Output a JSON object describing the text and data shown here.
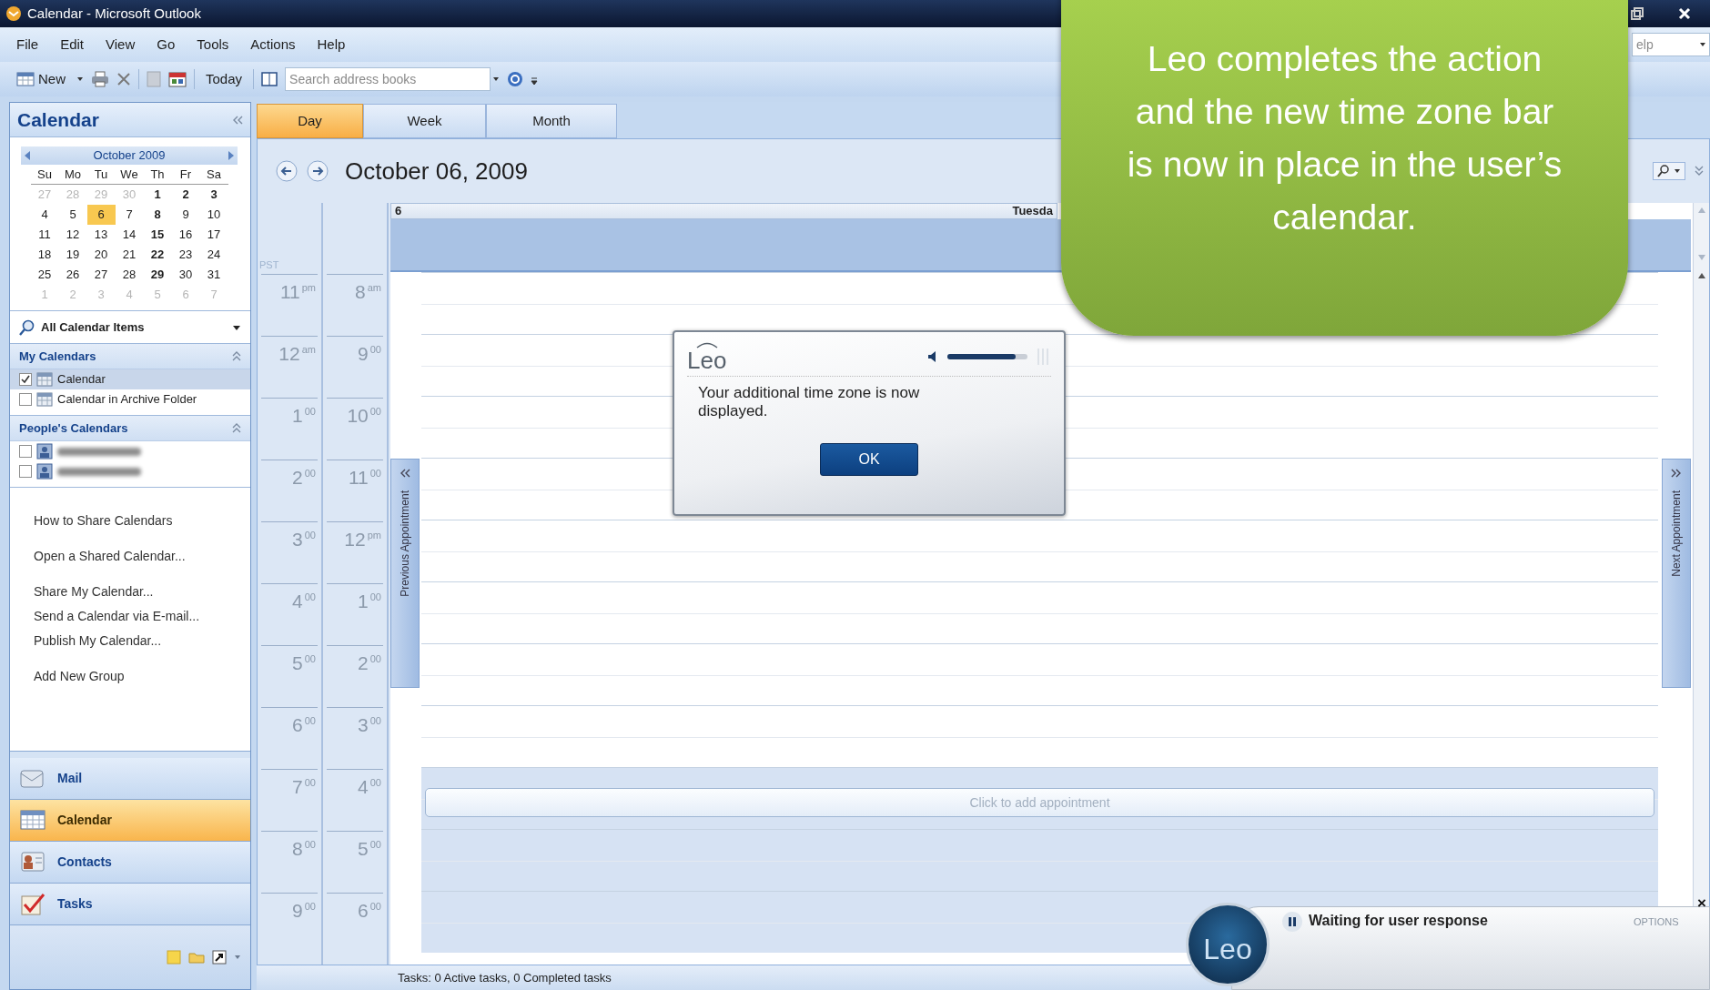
{
  "window": {
    "title": "Calendar - Microsoft Outlook"
  },
  "menu": [
    "File",
    "Edit",
    "View",
    "Go",
    "Tools",
    "Actions",
    "Help"
  ],
  "help_box": {
    "value": "elp"
  },
  "toolbar": {
    "new": "New",
    "today": "Today",
    "search": {
      "placeholder": "Search address books"
    }
  },
  "navigation_pane": {
    "title": "Calendar",
    "mini_calendar": {
      "month": "October 2009",
      "weekdays": [
        "Su",
        "Mo",
        "Tu",
        "We",
        "Th",
        "Fr",
        "Sa"
      ],
      "weeks": [
        [
          {
            "d": "27",
            "muted": true,
            "bold": false,
            "selected": false
          },
          {
            "d": "28",
            "muted": true,
            "bold": false,
            "selected": false
          },
          {
            "d": "29",
            "muted": true,
            "bold": false,
            "selected": false
          },
          {
            "d": "30",
            "muted": true,
            "bold": false,
            "selected": false
          },
          {
            "d": "1",
            "muted": false,
            "bold": true,
            "selected": false
          },
          {
            "d": "2",
            "muted": false,
            "bold": true,
            "selected": false
          },
          {
            "d": "3",
            "muted": false,
            "bold": true,
            "selected": false
          }
        ],
        [
          {
            "d": "4",
            "muted": false,
            "bold": false,
            "selected": false
          },
          {
            "d": "5",
            "muted": false,
            "bold": false,
            "selected": false
          },
          {
            "d": "6",
            "muted": false,
            "bold": false,
            "selected": true
          },
          {
            "d": "7",
            "muted": false,
            "bold": false,
            "selected": false
          },
          {
            "d": "8",
            "muted": false,
            "bold": true,
            "selected": false
          },
          {
            "d": "9",
            "muted": false,
            "bold": false,
            "selected": false
          },
          {
            "d": "10",
            "muted": false,
            "bold": false,
            "selected": false
          }
        ],
        [
          {
            "d": "11",
            "muted": false,
            "bold": false,
            "selected": false
          },
          {
            "d": "12",
            "muted": false,
            "bold": false,
            "selected": false
          },
          {
            "d": "13",
            "muted": false,
            "bold": false,
            "selected": false
          },
          {
            "d": "14",
            "muted": false,
            "bold": false,
            "selected": false
          },
          {
            "d": "15",
            "muted": false,
            "bold": true,
            "selected": false
          },
          {
            "d": "16",
            "muted": false,
            "bold": false,
            "selected": false
          },
          {
            "d": "17",
            "muted": false,
            "bold": false,
            "selected": false
          }
        ],
        [
          {
            "d": "18",
            "muted": false,
            "bold": false,
            "selected": false
          },
          {
            "d": "19",
            "muted": false,
            "bold": false,
            "selected": false
          },
          {
            "d": "20",
            "muted": false,
            "bold": false,
            "selected": false
          },
          {
            "d": "21",
            "muted": false,
            "bold": false,
            "selected": false
          },
          {
            "d": "22",
            "muted": false,
            "bold": true,
            "selected": false
          },
          {
            "d": "23",
            "muted": false,
            "bold": false,
            "selected": false
          },
          {
            "d": "24",
            "muted": false,
            "bold": false,
            "selected": false
          }
        ],
        [
          {
            "d": "25",
            "muted": false,
            "bold": false,
            "selected": false
          },
          {
            "d": "26",
            "muted": false,
            "bold": false,
            "selected": false
          },
          {
            "d": "27",
            "muted": false,
            "bold": false,
            "selected": false
          },
          {
            "d": "28",
            "muted": false,
            "bold": false,
            "selected": false
          },
          {
            "d": "29",
            "muted": false,
            "bold": true,
            "selected": false
          },
          {
            "d": "30",
            "muted": false,
            "bold": false,
            "selected": false
          },
          {
            "d": "31",
            "muted": false,
            "bold": false,
            "selected": false
          }
        ],
        [
          {
            "d": "1",
            "muted": true,
            "bold": false,
            "selected": false
          },
          {
            "d": "2",
            "muted": true,
            "bold": false,
            "selected": false
          },
          {
            "d": "3",
            "muted": true,
            "bold": false,
            "selected": false
          },
          {
            "d": "4",
            "muted": true,
            "bold": false,
            "selected": false
          },
          {
            "d": "5",
            "muted": true,
            "bold": false,
            "selected": false
          },
          {
            "d": "6",
            "muted": true,
            "bold": false,
            "selected": false
          },
          {
            "d": "7",
            "muted": true,
            "bold": false,
            "selected": false
          }
        ]
      ]
    },
    "view_filter": "All Calendar Items",
    "groups": [
      {
        "title": "My Calendars",
        "items": [
          {
            "kind": "calendar",
            "label": "Calendar",
            "checked": true,
            "selected": true
          },
          {
            "kind": "calendar",
            "label": "Calendar in Archive Folder",
            "checked": false,
            "selected": false
          }
        ]
      },
      {
        "title": "People's Calendars",
        "items": [
          {
            "kind": "blurred",
            "checked": false,
            "selected": false
          },
          {
            "kind": "blurred",
            "checked": false,
            "selected": false
          }
        ]
      }
    ],
    "link_groups": [
      [
        "How to Share Calendars"
      ],
      [
        "Open a Shared Calendar..."
      ],
      [
        "Share My Calendar...",
        "Send a Calendar via E-mail...",
        "Publish My Calendar..."
      ],
      [
        "Add New Group"
      ]
    ],
    "buttons": [
      {
        "kind": "mail",
        "label": "Mail",
        "selected": false
      },
      {
        "kind": "calendar",
        "label": "Calendar",
        "selected": true
      },
      {
        "kind": "contacts",
        "label": "Contacts",
        "selected": false
      },
      {
        "kind": "tasks",
        "label": "Tasks",
        "selected": false
      }
    ]
  },
  "view_tabs": [
    {
      "label": "Day",
      "selected": true
    },
    {
      "label": "Week",
      "selected": false
    },
    {
      "label": "Month",
      "selected": false
    }
  ],
  "date_title": "October 06, 2009",
  "day_header": {
    "day_number": "6",
    "day_name": "Tuesda"
  },
  "time_zone_label": "PST",
  "time_rows": [
    {
      "primary": {
        "h": "11",
        "s": "pm"
      },
      "secondary": {
        "h": "8",
        "s": "am"
      },
      "working": true
    },
    {
      "primary": {
        "h": "12",
        "s": "am"
      },
      "secondary": {
        "h": "9",
        "s": "00"
      },
      "working": true
    },
    {
      "primary": {
        "h": "1",
        "s": "00"
      },
      "secondary": {
        "h": "10",
        "s": "00"
      },
      "working": true
    },
    {
      "primary": {
        "h": "2",
        "s": "00"
      },
      "secondary": {
        "h": "11",
        "s": "00"
      },
      "working": true
    },
    {
      "primary": {
        "h": "3",
        "s": "00"
      },
      "secondary": {
        "h": "12",
        "s": "pm"
      },
      "working": true
    },
    {
      "primary": {
        "h": "4",
        "s": "00"
      },
      "secondary": {
        "h": "1",
        "s": "00"
      },
      "working": true
    },
    {
      "primary": {
        "h": "5",
        "s": "00"
      },
      "secondary": {
        "h": "2",
        "s": "00"
      },
      "working": true
    },
    {
      "primary": {
        "h": "6",
        "s": "00"
      },
      "secondary": {
        "h": "3",
        "s": "00"
      },
      "working": true
    },
    {
      "primary": {
        "h": "7",
        "s": "00"
      },
      "secondary": {
        "h": "4",
        "s": "00"
      },
      "working": false
    },
    {
      "primary": {
        "h": "8",
        "s": "00"
      },
      "secondary": {
        "h": "5",
        "s": "00"
      },
      "working": false
    },
    {
      "primary": {
        "h": "9",
        "s": "00"
      },
      "secondary": {
        "h": "6",
        "s": "00"
      },
      "working": false
    }
  ],
  "add_appointment": "Click to add appointment",
  "side_tabs": {
    "previous": "Previous Appointment",
    "next": "Next Appointment"
  },
  "status_bar": "Tasks: 0 Active tasks, 0 Completed tasks",
  "leo_dialog": {
    "logo": "Leo",
    "message": "Your additional time zone is now displayed.",
    "button": "OK",
    "volume": {
      "level": 0.85
    }
  },
  "leo_bar": {
    "logo": "Leo",
    "status": "Waiting for user response",
    "options": "OPTIONS",
    "close": "×"
  },
  "callout": "Leo completes the action and the new time zone bar is now in place in the user’s calendar."
}
